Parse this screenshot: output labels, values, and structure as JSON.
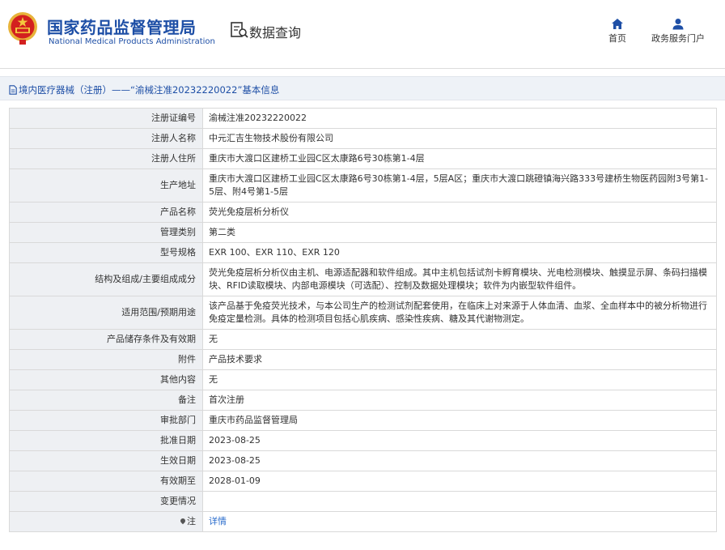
{
  "header": {
    "site_title": "国家药品监督管理局",
    "site_subtitle": "National Medical Products Administration",
    "section_title": "数据查询",
    "nav": [
      {
        "label": "首页",
        "icon": "home-icon"
      },
      {
        "label": "政务服务门户",
        "icon": "user-icon"
      }
    ]
  },
  "breadcrumb": {
    "text": "境内医疗器械（注册）——“渝械注准20232220022”基本信息"
  },
  "colors": {
    "brand_blue": "#1e4fa6",
    "label_bg": "#eef0f3",
    "link": "#2a6ccc",
    "border": "#d9d9d9"
  },
  "table": {
    "rows": [
      {
        "label": "注册证编号",
        "value": "渝械注准20232220022"
      },
      {
        "label": "注册人名称",
        "value": "中元汇吉生物技术股份有限公司"
      },
      {
        "label": "注册人住所",
        "value": "重庆市大渡口区建桥工业园C区太康路6号30栋第1-4层"
      },
      {
        "label": "生产地址",
        "value": "重庆市大渡口区建桥工业园C区太康路6号30栋第1-4层，5层A区；重庆市大渡口跳磴镇海兴路333号建桥生物医药园附3号第1-5层、附4号第1-5层"
      },
      {
        "label": "产品名称",
        "value": "荧光免疫层析分析仪"
      },
      {
        "label": "管理类别",
        "value": "第二类"
      },
      {
        "label": "型号规格",
        "value": "EXR 100、EXR 110、EXR 120"
      },
      {
        "label": "结构及组成/主要组成成分",
        "value": "荧光免疫层析分析仪由主机、电源适配器和软件组成。其中主机包括试剂卡孵育模块、光电检测模块、触摸显示屏、条码扫描模块、RFID读取模块、内部电源模块（可选配）、控制及数据处理模块；软件为内嵌型软件组件。"
      },
      {
        "label": "适用范围/预期用途",
        "value": "该产品基于免疫荧光技术，与本公司生产的检测试剂配套使用，在临床上对来源于人体血清、血浆、全血样本中的被分析物进行免疫定量检测。具体的检测项目包括心肌疾病、感染性疾病、糖及其代谢物测定。"
      },
      {
        "label": "产品储存条件及有效期",
        "value": "无"
      },
      {
        "label": "附件",
        "value": "产品技术要求"
      },
      {
        "label": "其他内容",
        "value": "无"
      },
      {
        "label": "备注",
        "value": "首次注册"
      },
      {
        "label": "审批部门",
        "value": "重庆市药品监督管理局"
      },
      {
        "label": "批准日期",
        "value": "2023-08-25"
      },
      {
        "label": "生效日期",
        "value": "2023-08-25"
      },
      {
        "label": "有效期至",
        "value": "2028-01-09"
      },
      {
        "label": "变更情况",
        "value": ""
      },
      {
        "label": "注",
        "value": "详情"
      }
    ]
  }
}
